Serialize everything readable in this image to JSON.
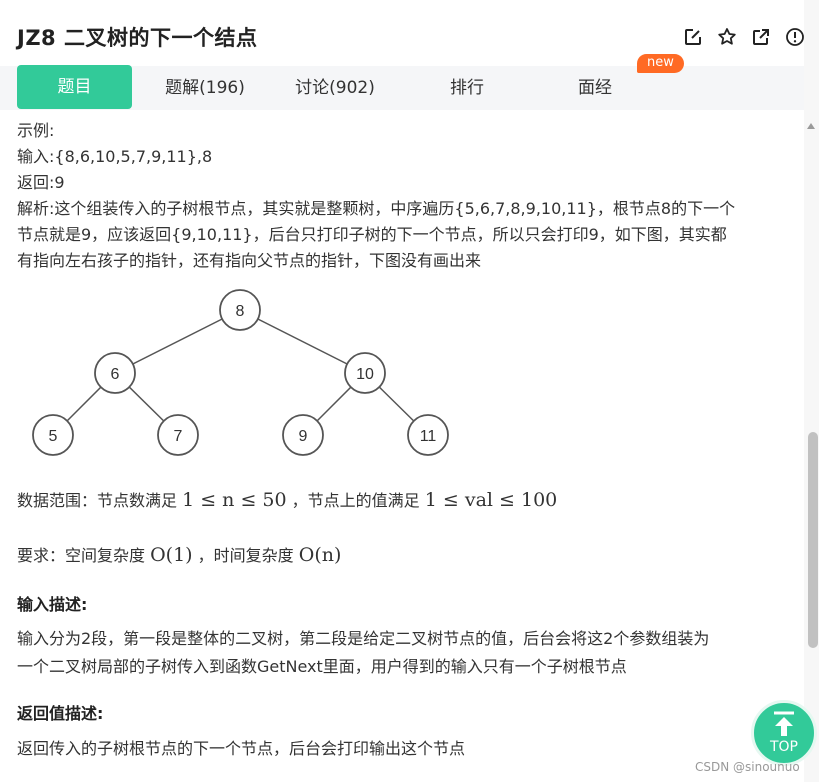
{
  "header": {
    "title": "JZ8  二叉树的下一个结点",
    "icons": [
      "edit-icon",
      "star-icon",
      "share-icon",
      "info-icon"
    ]
  },
  "tabs": [
    {
      "label": "题目",
      "active": true
    },
    {
      "label": "题解(196)",
      "active": false
    },
    {
      "label": "讨论(902)",
      "active": false
    },
    {
      "label": "排行",
      "active": false
    },
    {
      "label": "面经",
      "active": false
    }
  ],
  "badge": "new",
  "content": {
    "lines": [
      "示例:",
      "输入:{8,6,10,5,7,9,11},8",
      "返回:9",
      "解析:这个组装传入的子树根节点，其实就是整颗树，中序遍历{5,6,7,8,9,10,11}，根节点8的下一个",
      "节点就是9，应该返回{9,10,11}，后台只打印子树的下一个节点，所以只会打印9，如下图，其实都",
      "有指向左右孩子的指针，还有指向父节点的指针，下图没有画出来"
    ],
    "tree_nodes": [
      "8",
      "6",
      "10",
      "5",
      "7",
      "9",
      "11"
    ],
    "range": {
      "prefix": "数据范围：节点数满足 ",
      "formula1": "1 ≤ n ≤ 50",
      "middle": " ，节点上的值满足 ",
      "formula2": "1 ≤ val ≤ 100"
    },
    "requirement": {
      "prefix": "要求：空间复杂度 ",
      "formula1": "O(1)",
      "middle": " ，时间复杂度 ",
      "formula2": "O(n)"
    },
    "input_title": "输入描述:",
    "input_lines": [
      "输入分为2段，第一段是整体的二叉树，第二段是给定二叉树节点的值，后台会将这2个参数组装为",
      "一个二叉树局部的子树传入到函数GetNext里面，用户得到的输入只有一个子树根节点"
    ],
    "return_title": "返回值描述:",
    "return_line": "返回传入的子树根节点的下一个节点，后台会打印输出这个节点"
  },
  "top_button": "TOP",
  "watermark": "CSDN @sinounuo",
  "colors": {
    "accent": "#32ca99",
    "badge": "#ff6a24"
  }
}
